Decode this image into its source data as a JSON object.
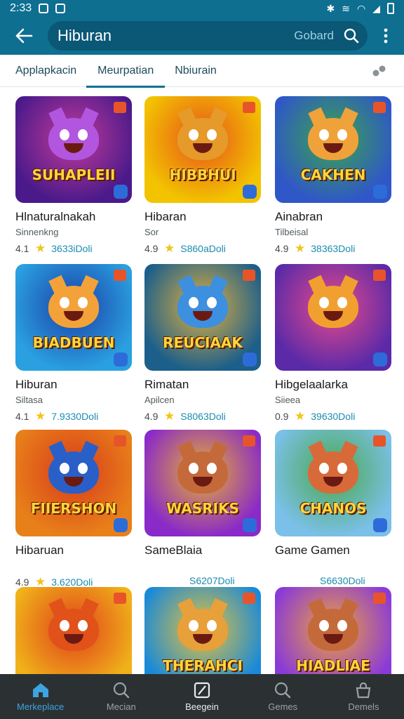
{
  "status_bar": {
    "time": "2:33"
  },
  "app_bar": {
    "search_value": "Hiburan",
    "search_hint": "Gobard"
  },
  "tabs": [
    {
      "label": "Applapkacin",
      "active": false
    },
    {
      "label": "Meurpatian",
      "active": true
    },
    {
      "label": "Nbiurain",
      "active": false
    }
  ],
  "games": [
    {
      "thumb_title": "SUHAPLEII",
      "name": "Hlnaturalnakah",
      "sub": "Sinnenkng",
      "num": "4.1",
      "price": "3633iDoli",
      "bg": [
        "#4a1a8a",
        "#c23a9a"
      ],
      "face": "#b256e0"
    },
    {
      "thumb_title": "HIBBHUI",
      "name": "Hibaran",
      "sub": "Sor",
      "num": "4.9",
      "price": "S860aDoli",
      "bg": [
        "#f2c400",
        "#e8531a"
      ],
      "face": "#e69a2a"
    },
    {
      "thumb_title": "CAKHEN",
      "name": "Ainabran",
      "sub": "Tilbeisal",
      "num": "4.9",
      "price": "38363Doli",
      "bg": [
        "#2f57c8",
        "#3aa64a"
      ],
      "face": "#f0a23a"
    },
    {
      "thumb_title": "BIADBUEN",
      "name": "Hiburan",
      "sub": "Siltasa",
      "num": "4.1",
      "price": "7.9330Doli",
      "bg": [
        "#2aa0e0",
        "#1b3fa8"
      ],
      "face": "#f3a23a"
    },
    {
      "thumb_title": "REUCIAAK",
      "name": "Rimatan",
      "sub": "Apilcen",
      "num": "4.9",
      "price": "S8063Doli",
      "bg": [
        "#1c5f8a",
        "#e0b040"
      ],
      "face": "#3d8fe0"
    },
    {
      "thumb_title": "",
      "name": "Hibgelaalarka",
      "sub": "Siieea",
      "num": "0.9",
      "price": "39630Doli",
      "bg": [
        "#5b2aa8",
        "#e84a8a"
      ],
      "face": "#f1a030"
    },
    {
      "thumb_title": "FIIERSHON",
      "name": "Hibaruan",
      "sub": "",
      "num": "4.9",
      "price": "3.620Doli",
      "bg": [
        "#e8801a",
        "#d83a1a"
      ],
      "face": "#2a5fc8"
    },
    {
      "thumb_title": "WASRIKS",
      "name": "SameBlaia",
      "sub": "",
      "num": "",
      "price": "S6207Doli",
      "bg": [
        "#8a2ac8",
        "#e8b030"
      ],
      "face": "#c46a3a"
    },
    {
      "thumb_title": "CHANOS",
      "name": "Game Gamen",
      "sub": "",
      "num": "",
      "price": "S6630Doli",
      "bg": [
        "#7ac0e8",
        "#4aa84a"
      ],
      "face": "#d86a3a"
    },
    {
      "thumb_title": "",
      "name": "",
      "sub": "",
      "num": "",
      "price": "",
      "bg": [
        "#f0b21a",
        "#e0401a"
      ],
      "face": "#e0521a"
    },
    {
      "thumb_title": "THERAHCI",
      "name": "",
      "sub": "",
      "num": "",
      "price": "",
      "bg": [
        "#1a8ad8",
        "#e8c23a"
      ],
      "face": "#e8a03a"
    },
    {
      "thumb_title": "HIADLIAE",
      "name": "",
      "sub": "",
      "num": "",
      "price": "",
      "bg": [
        "#8a3ad8",
        "#f0a23a"
      ],
      "face": "#c46a3a"
    }
  ],
  "bottom_nav": [
    {
      "label": "Merkeplace",
      "icon": "home-icon",
      "active": true
    },
    {
      "label": "Mecian",
      "icon": "search-icon",
      "active": false
    },
    {
      "label": "Beegein",
      "icon": "bookmark-icon",
      "active": false
    },
    {
      "label": "Gemes",
      "icon": "search-icon",
      "active": false
    },
    {
      "label": "Demels",
      "icon": "bag-icon",
      "active": false
    }
  ],
  "colors": {
    "primary": "#0e6f91",
    "accent": "#3da4e0",
    "price": "#1b8bb0",
    "star": "#f0c419",
    "nav_bg": "#2b3133"
  }
}
